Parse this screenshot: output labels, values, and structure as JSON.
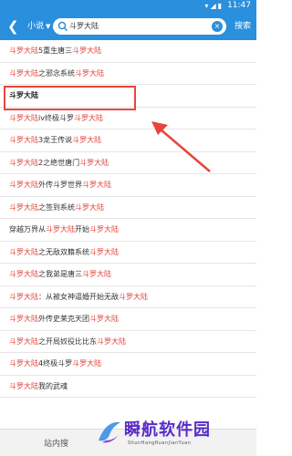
{
  "status_bar": {
    "time": "11:47"
  },
  "header": {
    "scope_label": "小说",
    "search_value": "斗罗大陆",
    "search_button": "搜索"
  },
  "results": [
    {
      "hl": "斗罗大陆",
      "rest": "5重生唐三",
      "hl2": "斗罗大陆"
    },
    {
      "hl": "斗罗大陆",
      "rest": "之邪念系统",
      "hl2": "斗罗大陆"
    },
    {
      "hl": "斗罗大陆",
      "rest": "",
      "hl2": ""
    },
    {
      "hl": "斗罗大陆",
      "rest": "iv终极斗罗",
      "hl2": "斗罗大陆"
    },
    {
      "hl": "斗罗大陆",
      "rest": "3龙王传说",
      "hl2": "斗罗大陆"
    },
    {
      "hl": "斗罗大陆",
      "rest": "2之绝世唐门",
      "hl2": "斗罗大陆"
    },
    {
      "hl": "斗罗大陆",
      "rest": "外传斗罗世界",
      "hl2": "斗罗大陆"
    },
    {
      "hl": "斗罗大陆",
      "rest": "之签到系统",
      "hl2": "斗罗大陆"
    },
    {
      "pre": "穿越万界从",
      "hl": "斗罗大陆",
      "rest": "开始",
      "hl2": "斗罗大陆"
    },
    {
      "hl": "斗罗大陆",
      "rest": "之无敌双籍系统",
      "hl2": "斗罗大陆"
    },
    {
      "hl": "斗罗大陆",
      "rest": "之我弟是唐三",
      "hl2": "斗罗大陆"
    },
    {
      "hl": "斗罗大陆",
      "rest": "：从被女神逼婚开始无敌",
      "hl2": "斗罗大陆"
    },
    {
      "hl": "斗罗大陆",
      "rest": "外传史莱克天团",
      "hl2": "斗罗大陆"
    },
    {
      "hl": "斗罗大陆",
      "rest": "之开局奴役比比东",
      "hl2": "斗罗大陆"
    },
    {
      "hl": "斗罗大陆",
      "rest": "4终极斗罗",
      "hl2": "斗罗大陆"
    },
    {
      "hl": "斗罗大陆",
      "rest": "我的武魂",
      "hl2": ""
    }
  ],
  "bottom_bar": {
    "tab_label": "站内搜"
  },
  "watermark": {
    "title": "瞬航软件园",
    "subtitle": "ShunHangRuanJianYuan"
  },
  "colors": {
    "accent": "#2a8fdc",
    "highlight": "#e0433a",
    "annotation": "#e8453c"
  }
}
